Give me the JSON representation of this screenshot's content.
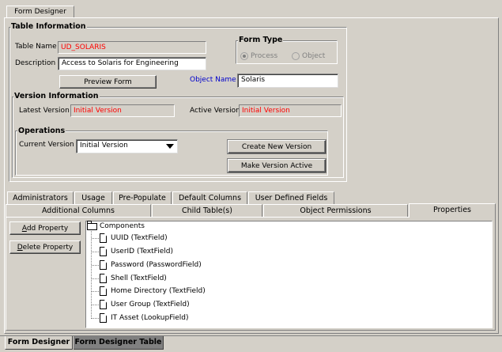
{
  "window_tab": "Form Designer",
  "table_info": {
    "title": "Table Information",
    "table_name_label": "Table Name",
    "table_name_value": "UD_SOLARIS",
    "description_label": "Description",
    "description_value": "Access to Solaris for Engineering",
    "preview_button": "Preview Form",
    "object_name_label": "Object Name",
    "object_name_value": "Solaris"
  },
  "form_type": {
    "title": "Form Type",
    "options": [
      "Process",
      "Object"
    ],
    "selected": "Process"
  },
  "version_info": {
    "title": "Version Information",
    "latest_label": "Latest Version",
    "latest_value": "Initial Version",
    "active_label": "Active Version",
    "active_value": "Initial Version"
  },
  "operations": {
    "title": "Operations",
    "current_label": "Current Version",
    "current_value": "Initial Version",
    "create_button": "Create New Version",
    "make_active_button": "Make Version Active"
  },
  "tabs_row1": [
    "Administrators",
    "Usage",
    "Pre-Populate",
    "Default Columns",
    "User Defined Fields"
  ],
  "tabs_row2": [
    "Additional Columns",
    "Child Table(s)",
    "Object Permissions",
    "Properties"
  ],
  "active_tab": "Properties",
  "properties": {
    "add_button": "Add Property",
    "delete_button": "Delete Property",
    "tree_root": "Components",
    "tree_items": [
      "UUID (TextField)",
      "UserID (TextField)",
      "Password (PasswordField)",
      "Shell (TextField)",
      "Home Directory (TextField)",
      "User Group (TextField)",
      "IT Asset (LookupField)"
    ]
  },
  "bottom_tabs": [
    "Form Designer",
    "Form Designer Table"
  ],
  "colors": {
    "background": "#d4d0c8",
    "readonly_value_text": "#ff0000",
    "object_name_label": "#0000cc",
    "inactive_bottom_tab": "#808080"
  },
  "icons": [
    "folder-icon",
    "document-icon",
    "dropdown-arrow-icon"
  ]
}
